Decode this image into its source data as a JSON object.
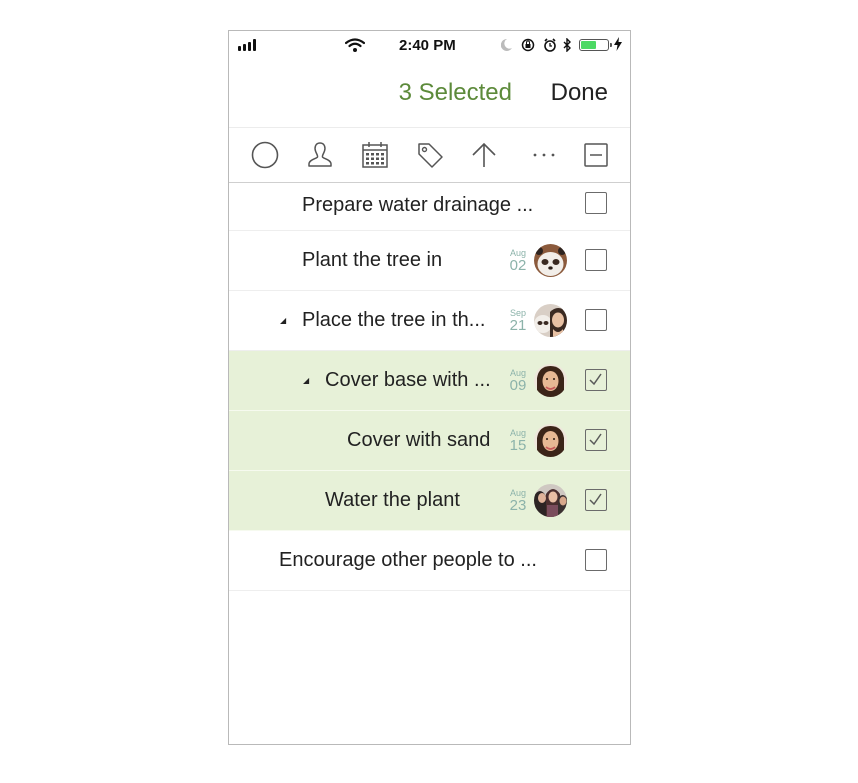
{
  "status_bar": {
    "time": "2:40 PM"
  },
  "header": {
    "selected_label": "3 Selected",
    "done_label": "Done"
  },
  "toolbar": {
    "icons": [
      "circle-icon",
      "person-icon",
      "calendar-icon",
      "tag-icon",
      "arrow-up-icon",
      "more-icon",
      "deselect-icon"
    ]
  },
  "tasks": [
    {
      "title": "Prepare water drainage ...",
      "month": "",
      "day": "",
      "avatar": "",
      "checked": false,
      "selected": false
    },
    {
      "title": "Plant the tree in",
      "month": "Aug",
      "day": "02",
      "avatar": "panda",
      "checked": false,
      "selected": false
    },
    {
      "title": "Place the tree in th...",
      "month": "Sep",
      "day": "21",
      "avatar": "panda+woman",
      "checked": false,
      "selected": false
    },
    {
      "title": "Cover base with ...",
      "month": "Aug",
      "day": "09",
      "avatar": "woman",
      "checked": true,
      "selected": true
    },
    {
      "title": "Cover with sand",
      "month": "Aug",
      "day": "15",
      "avatar": "woman",
      "checked": true,
      "selected": true
    },
    {
      "title": "Water the plant",
      "month": "Aug",
      "day": "23",
      "avatar": "group",
      "checked": true,
      "selected": true
    },
    {
      "title": "Encourage other people to ...",
      "month": "",
      "day": "",
      "avatar": "",
      "checked": false,
      "selected": false
    }
  ],
  "colors": {
    "selected_row_bg": "#e7f1d8",
    "accent_green": "#5c8a3a",
    "date_teal": "#8cb3aa",
    "battery_green": "#4cd964"
  }
}
